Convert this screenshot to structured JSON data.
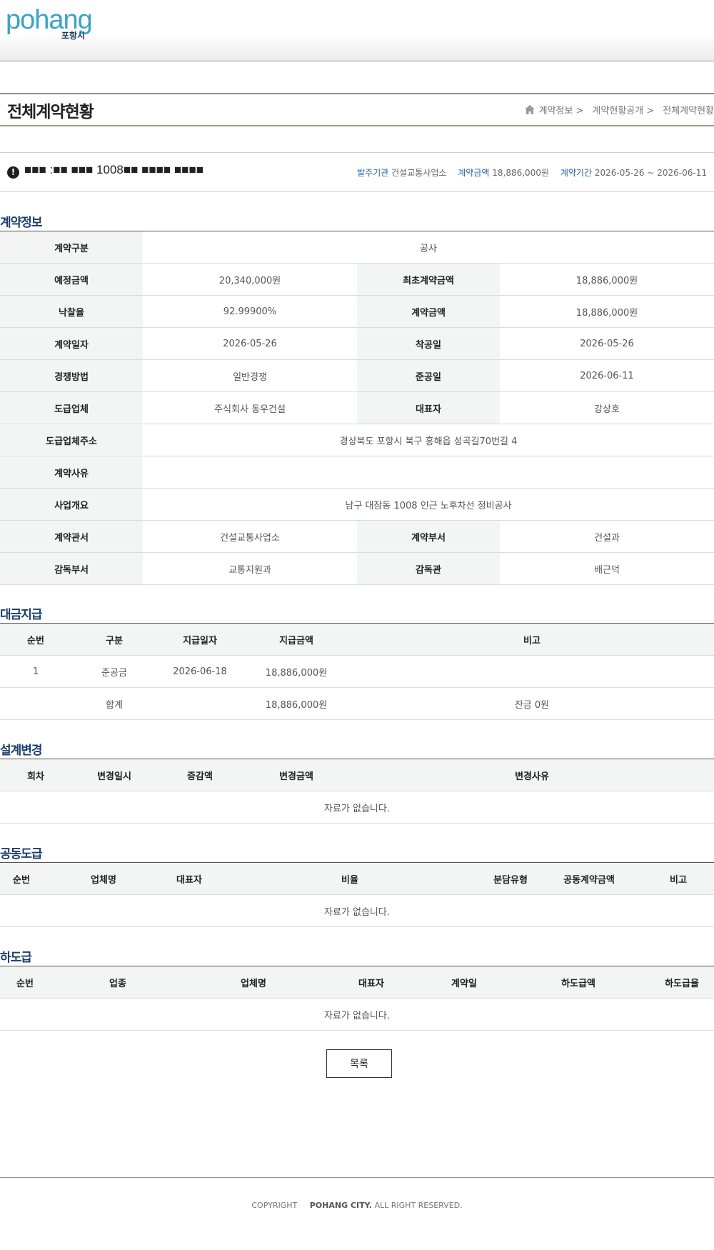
{
  "header": {
    "logo_text": "pohang",
    "logo_subtext": "포항시"
  },
  "page": {
    "title": "전체계약현황",
    "breadcrumb": [
      "계약정보 >",
      "계약현황공개 >",
      "전체계약현황"
    ]
  },
  "subject": {
    "title": "■■■ :■■ ■■■ 1008■■ ■■■■ ■■■■",
    "meta": [
      {
        "label": "발주기관",
        "value": "건설교통사업소"
      },
      {
        "label": "계약금액",
        "value": "18,886,000원"
      },
      {
        "label": "계약기간",
        "value": "2026-05-26 ~ 2026-06-11"
      }
    ]
  },
  "contract_info": {
    "section_title": "계약정보",
    "rows": [
      {
        "cells": [
          {
            "label": "계약구분",
            "value": "공사",
            "span": true
          }
        ]
      },
      {
        "cells": [
          {
            "label": "예정금액",
            "value": "20,340,000원"
          },
          {
            "label": "최초계약금액",
            "value": "18,886,000원"
          }
        ]
      },
      {
        "cells": [
          {
            "label": "낙찰율",
            "value": "92.99900%"
          },
          {
            "label": "계약금액",
            "value": "18,886,000원"
          }
        ]
      },
      {
        "cells": [
          {
            "label": "계약일자",
            "value": "2026-05-26"
          },
          {
            "label": "착공일",
            "value": "2026-05-26"
          }
        ]
      },
      {
        "cells": [
          {
            "label": "경쟁방법",
            "value": "일반경쟁"
          },
          {
            "label": "준공일",
            "value": "2026-06-11"
          }
        ]
      },
      {
        "cells": [
          {
            "label": "도급업체",
            "value": "주식회사 동우건설"
          },
          {
            "label": "대표자",
            "value": "강상호"
          }
        ]
      },
      {
        "cells": [
          {
            "label": "도급업체주소",
            "value": "경상북도 포항시 북구 흥해읍 성곡길70번길 4",
            "span": true
          }
        ]
      },
      {
        "cells": [
          {
            "label": "계약사유",
            "value": "",
            "span": true
          }
        ]
      },
      {
        "cells": [
          {
            "label": "사업개요",
            "value": "남구 대잠동 1008 인근 노후차선 정비공사",
            "span": true
          }
        ]
      },
      {
        "cells": [
          {
            "label": "계약관서",
            "value": "건설교통사업소"
          },
          {
            "label": "계약부서",
            "value": "건설과"
          }
        ]
      },
      {
        "cells": [
          {
            "label": "감독부서",
            "value": "교통지원과"
          },
          {
            "label": "감독관",
            "value": "배근덕"
          }
        ]
      }
    ]
  },
  "payment": {
    "section_title": "대금지급",
    "headers": [
      "순번",
      "구분",
      "지급일자",
      "지급금액",
      "비고"
    ],
    "rows": [
      [
        "1",
        "준공금",
        "2026-06-18",
        "18,886,000원",
        ""
      ]
    ],
    "total": {
      "label": "합계",
      "amount": "18,886,000원",
      "note": "잔금 0원"
    }
  },
  "design_change": {
    "section_title": "설계변경",
    "headers": [
      "회차",
      "변경일시",
      "증감액",
      "변경금액",
      "변경사유"
    ],
    "empty_text": "자료가 없습니다."
  },
  "joint_contract": {
    "section_title": "공동도급",
    "headers": [
      "순번",
      "업체명",
      "대표자",
      "비율",
      "분담유형",
      "공동계약금액",
      "비고"
    ],
    "empty_text": "자료가 없습니다."
  },
  "subcontract": {
    "section_title": "하도급",
    "headers": [
      "순번",
      "업종",
      "업체명",
      "대표자",
      "계약일",
      "하도급액",
      "하도급율"
    ],
    "empty_text": "자료가 없습니다."
  },
  "buttons": {
    "list_label": "목록"
  },
  "footer": {
    "copyright": "COPYRIGHT",
    "org": "POHANG CITY.",
    "rights": "ALL RIGHT RESERVED."
  }
}
